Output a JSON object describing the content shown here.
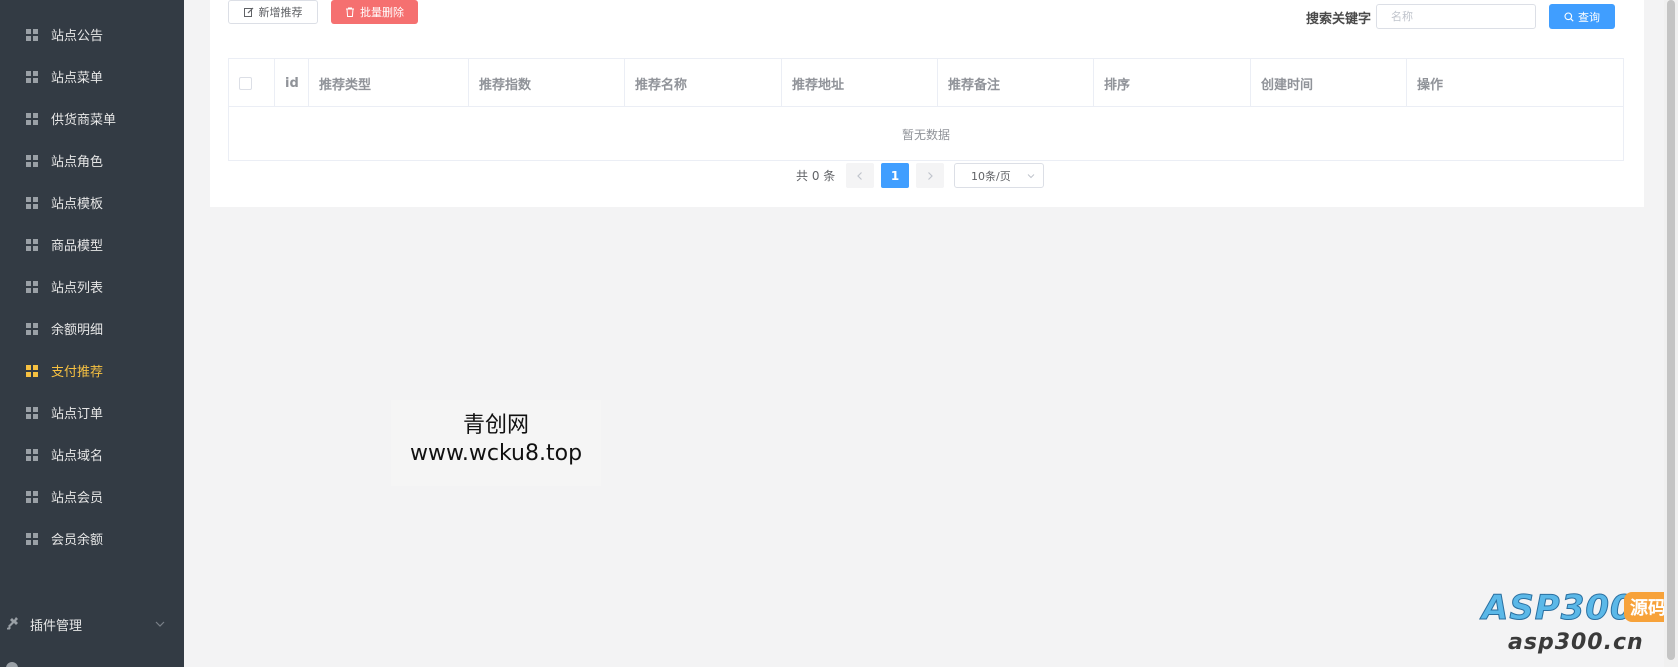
{
  "sidebar": {
    "items": [
      {
        "label": "站点公告",
        "active": false
      },
      {
        "label": "站点菜单",
        "active": false
      },
      {
        "label": "供货商菜单",
        "active": false
      },
      {
        "label": "站点角色",
        "active": false
      },
      {
        "label": "站点模板",
        "active": false
      },
      {
        "label": "商品模型",
        "active": false
      },
      {
        "label": "站点列表",
        "active": false
      },
      {
        "label": "余额明细",
        "active": false
      },
      {
        "label": "支付推荐",
        "active": true
      },
      {
        "label": "站点订单",
        "active": false
      },
      {
        "label": "站点域名",
        "active": false
      },
      {
        "label": "站点会员",
        "active": false
      },
      {
        "label": "会员余额",
        "active": false
      }
    ],
    "group": {
      "label": "插件管理",
      "icon": "plug-icon"
    },
    "active_color": "#f7c141",
    "bg_color": "#333b44"
  },
  "toolbar": {
    "add_label": "新增推荐",
    "delete_label": "批量删除",
    "search_label": "搜索关键字",
    "search_placeholder": "名称",
    "query_label": "查询"
  },
  "table": {
    "columns": [
      "id",
      "推荐类型",
      "推荐指数",
      "推荐名称",
      "推荐地址",
      "推荐备注",
      "排序",
      "创建时间",
      "操作"
    ],
    "empty_text": "暂无数据"
  },
  "pagination": {
    "total_text": "共 0 条",
    "current_page": "1",
    "page_size": "10条/页"
  },
  "watermark": {
    "line1": "青创网",
    "line2": "www.wcku8.top"
  },
  "logo": {
    "big": "ASP300",
    "tag": "源码",
    "sub": "asp300.cn"
  },
  "colors": {
    "primary": "#409eff",
    "danger": "#f57070",
    "page_bg": "#f3f3f4"
  }
}
